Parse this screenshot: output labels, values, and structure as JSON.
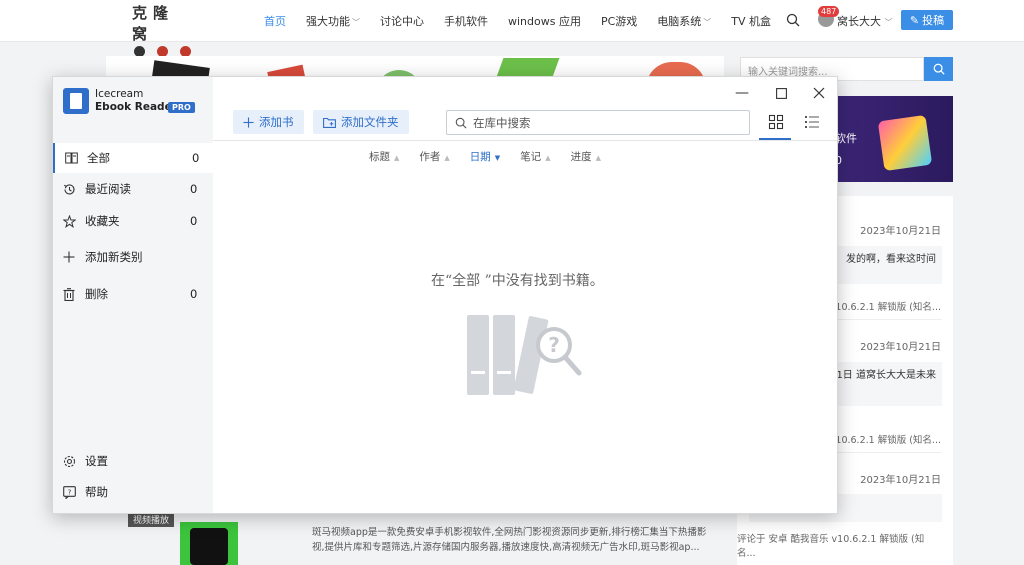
{
  "site": {
    "logo_text": "克隆窝",
    "nav": [
      {
        "label": "首页",
        "active": true,
        "caret": false
      },
      {
        "label": "强大功能",
        "active": false,
        "caret": true
      },
      {
        "label": "讨论中心",
        "active": false,
        "caret": false
      },
      {
        "label": "手机软件",
        "active": false,
        "caret": false
      },
      {
        "label": "windows 应用",
        "active": false,
        "caret": false
      },
      {
        "label": "PC游戏",
        "active": false,
        "caret": false
      },
      {
        "label": "电脑系统",
        "active": false,
        "caret": true
      },
      {
        "label": "TV 机盒",
        "active": false,
        "caret": false
      }
    ],
    "user_badge": "487",
    "user_name": "窝长大大",
    "contribute_label": "投稿",
    "sidebar_search_placeholder": "输入关键词搜索...",
    "ad_text_1": "软件",
    "ad_text_2": "0",
    "comments": [
      {
        "date": "2023年10月21日",
        "text": "发的啊，看来这时间",
        "meta": "v10.6.2.1 解锁版 (知名..."
      },
      {
        "date": "2023年10月21日",
        "text": "间怎么会是10月21日 道窝长大大是未来",
        "meta": "v10.6.2.1 解锁版 (知名..."
      },
      {
        "date": "2023年10月21日",
        "text": "",
        "meta": "评论于 安卓 酷我音乐 v10.6.2.1 解锁版 (知名..."
      }
    ],
    "post_tag": "视频播放",
    "post_desc": "斑马视频app是一款免费安卓手机影视软件,全网热门影视资源同步更新,排行榜汇集当下热播影视,提供片库和专题筛选,片源存储国内服务器,播放速度快,高清视频无广告水印,斑马影视ap..."
  },
  "app": {
    "brand_line1": "Icecream",
    "brand_line2": "Ebook Reader",
    "pro_label": "PRO",
    "sidebar_items": [
      {
        "label": "全部",
        "count": "0",
        "icon": "book-open-icon"
      },
      {
        "label": "最近阅读",
        "count": "0",
        "icon": "history-icon"
      },
      {
        "label": "收藏夹",
        "count": "0",
        "icon": "star-icon"
      },
      {
        "label": "添加新类别",
        "count": "",
        "icon": "plus-icon"
      },
      {
        "label": "删除",
        "count": "0",
        "icon": "trash-icon"
      }
    ],
    "settings_label": "设置",
    "help_label": "帮助",
    "add_book_label": "添加书",
    "add_folder_label": "添加文件夹",
    "search_placeholder": "在库中搜索",
    "sort_columns": [
      {
        "label": "标题",
        "active": false
      },
      {
        "label": "作者",
        "active": false
      },
      {
        "label": "日期",
        "active": true
      },
      {
        "label": "笔记",
        "active": false
      },
      {
        "label": "进度",
        "active": false
      }
    ],
    "empty_message": "在“全部 ”中没有找到书籍。",
    "accent_color": "#2f6fc9"
  }
}
